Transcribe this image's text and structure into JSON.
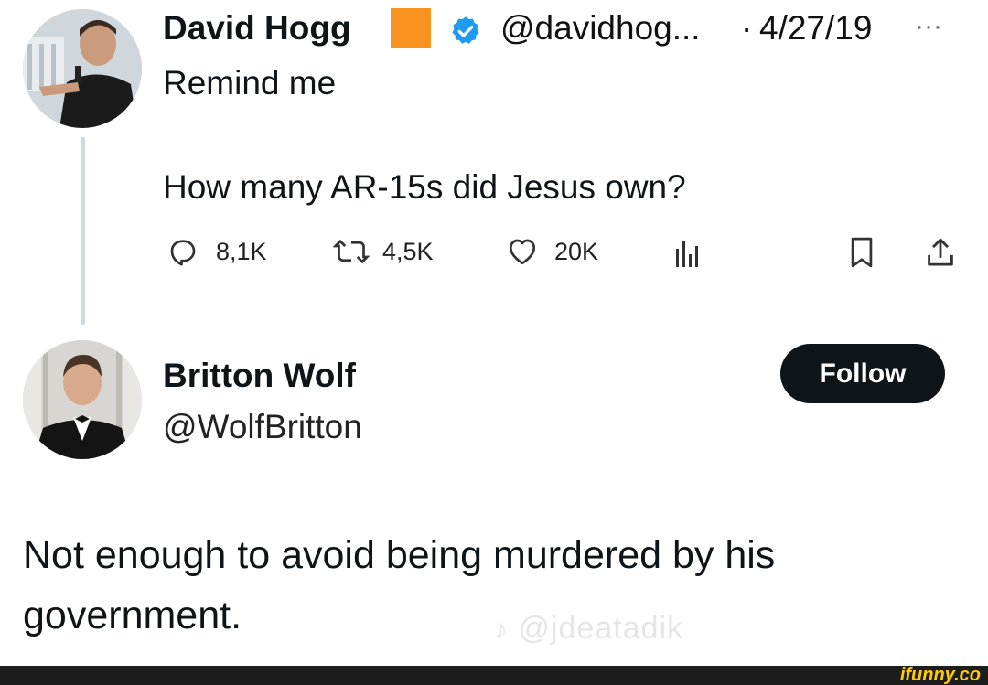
{
  "tweet": {
    "author_name": "David Hogg",
    "badge_color": "#f7931e",
    "verified_color": "#1d9bf0",
    "handle": "@davidhog...",
    "separator": "·",
    "date": "4/27/19",
    "more": "···",
    "line1": "Remind me",
    "line2": "How many AR-15s did Jesus own?",
    "stats": {
      "replies": "8,1K",
      "retweets": "4,5K",
      "likes": "20K"
    }
  },
  "reply_author": {
    "name": "Britton Wolf",
    "handle": "@WolfBritton",
    "follow_label": "Follow"
  },
  "reply": {
    "line1": "Not enough to avoid being murdered by his",
    "line2": "government."
  },
  "watermark": "@jdeatadik",
  "footer": {
    "brand": "ifunny.co"
  }
}
